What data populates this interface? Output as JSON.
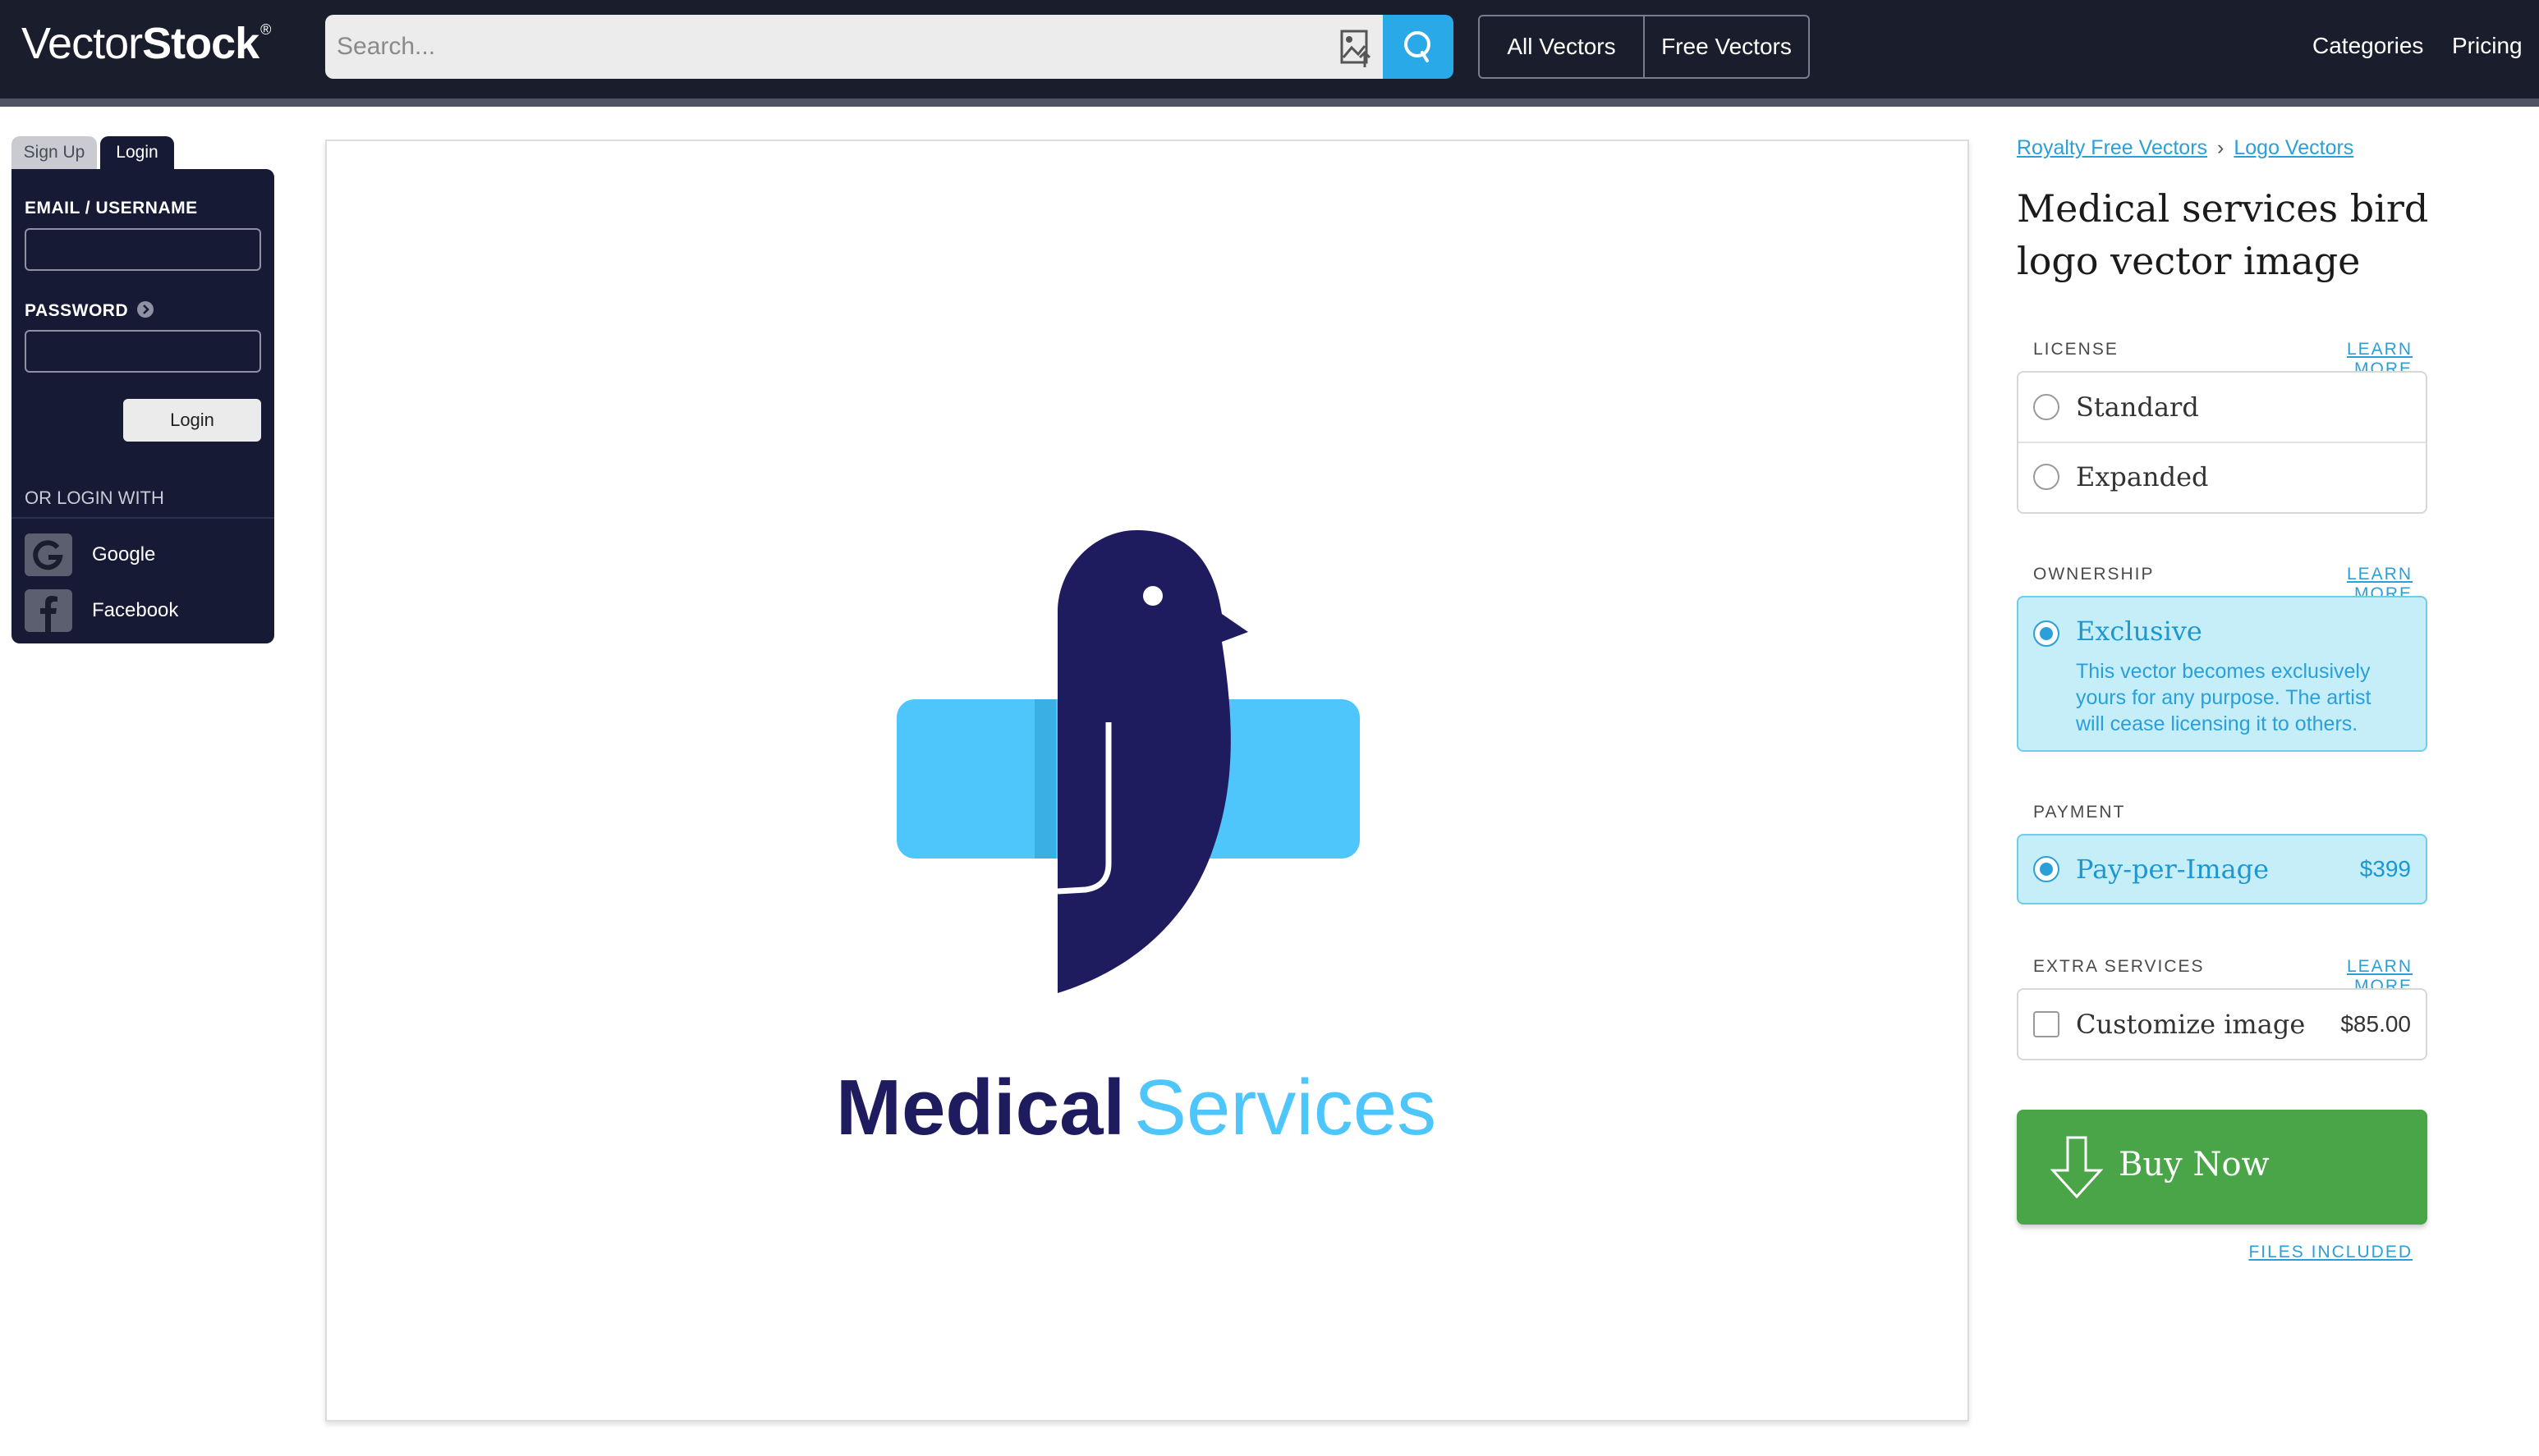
{
  "brand": {
    "name_light": "Vector",
    "name_bold": "Stock",
    "mark": "®"
  },
  "search": {
    "placeholder": "Search..."
  },
  "nav": {
    "all_vectors": "All Vectors",
    "free_vectors": "Free Vectors",
    "categories": "Categories",
    "pricing": "Pricing"
  },
  "auth": {
    "tab_signup": "Sign Up",
    "tab_login": "Login",
    "email_label": "EMAIL / USERNAME",
    "password_label": "PASSWORD",
    "login_button": "Login",
    "or_login_with": "OR LOGIN WITH",
    "google": "Google",
    "facebook": "Facebook"
  },
  "preview": {
    "word1": "Medical",
    "word2": "Services",
    "colors": {
      "navy": "#1e1c5e",
      "sky": "#4ec6fb",
      "sky_dark": "#3aafe3"
    }
  },
  "breadcrumb": {
    "item1": "Royalty Free Vectors",
    "separator": "›",
    "item2": "Logo Vectors"
  },
  "product": {
    "title": "Medical services bird logo vector image"
  },
  "license": {
    "label": "LICENSE",
    "learn_more": "LEARN MORE",
    "options": [
      {
        "label": "Standard",
        "selected": false
      },
      {
        "label": "Expanded",
        "selected": false
      }
    ]
  },
  "ownership": {
    "label": "OWNERSHIP",
    "learn_more": "LEARN MORE",
    "option": "Exclusive",
    "description": "This vector becomes exclusively yours for any purpose. The artist will cease licensing it to others."
  },
  "payment": {
    "label": "PAYMENT",
    "option": "Pay-per-Image",
    "price": "$399"
  },
  "extras": {
    "label": "EXTRA SERVICES",
    "learn_more": "LEARN MORE",
    "option": "Customize image",
    "price": "$85.00"
  },
  "buy": {
    "label": "Buy Now",
    "files_included": "FILES INCLUDED"
  },
  "colors": {
    "topbar": "#1a1d2b",
    "accent": "#2a9fd8",
    "buy_green": "#4aa548",
    "selected_bg": "#c6eef8"
  }
}
